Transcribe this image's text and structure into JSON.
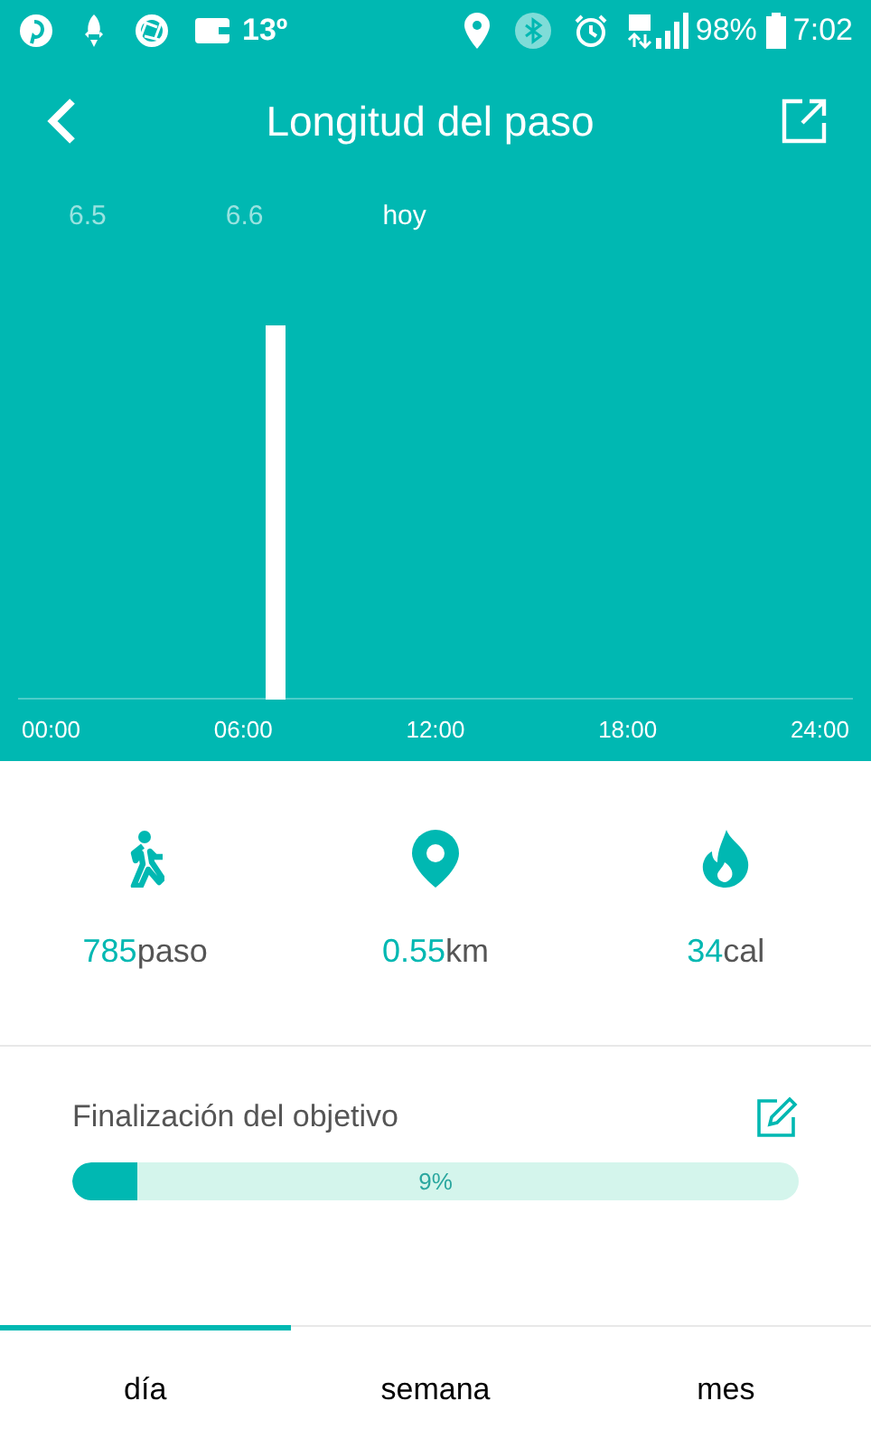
{
  "status_bar": {
    "temperature": "13º",
    "battery_percent": "98%",
    "time": "7:02"
  },
  "header": {
    "title": "Longitud del paso"
  },
  "dates": [
    {
      "label": "6.5",
      "selected": false
    },
    {
      "label": "6.6",
      "selected": false
    },
    {
      "label": "hoy",
      "selected": true
    }
  ],
  "chart": {
    "x_labels": [
      "00:00",
      "06:00",
      "12:00",
      "18:00",
      "24:00"
    ]
  },
  "stats": [
    {
      "kind": "steps",
      "value": "785",
      "unit": "paso"
    },
    {
      "kind": "distance",
      "value": "0.55",
      "unit": "km"
    },
    {
      "kind": "calories",
      "value": "34",
      "unit": "cal"
    }
  ],
  "goal": {
    "title": "Finalización del objetivo",
    "level": 0.09,
    "reading": "9%"
  },
  "tabs": [
    {
      "label": "día",
      "selected": true
    },
    {
      "label": "semana",
      "selected": false
    },
    {
      "label": "mes",
      "selected": false
    }
  ]
}
